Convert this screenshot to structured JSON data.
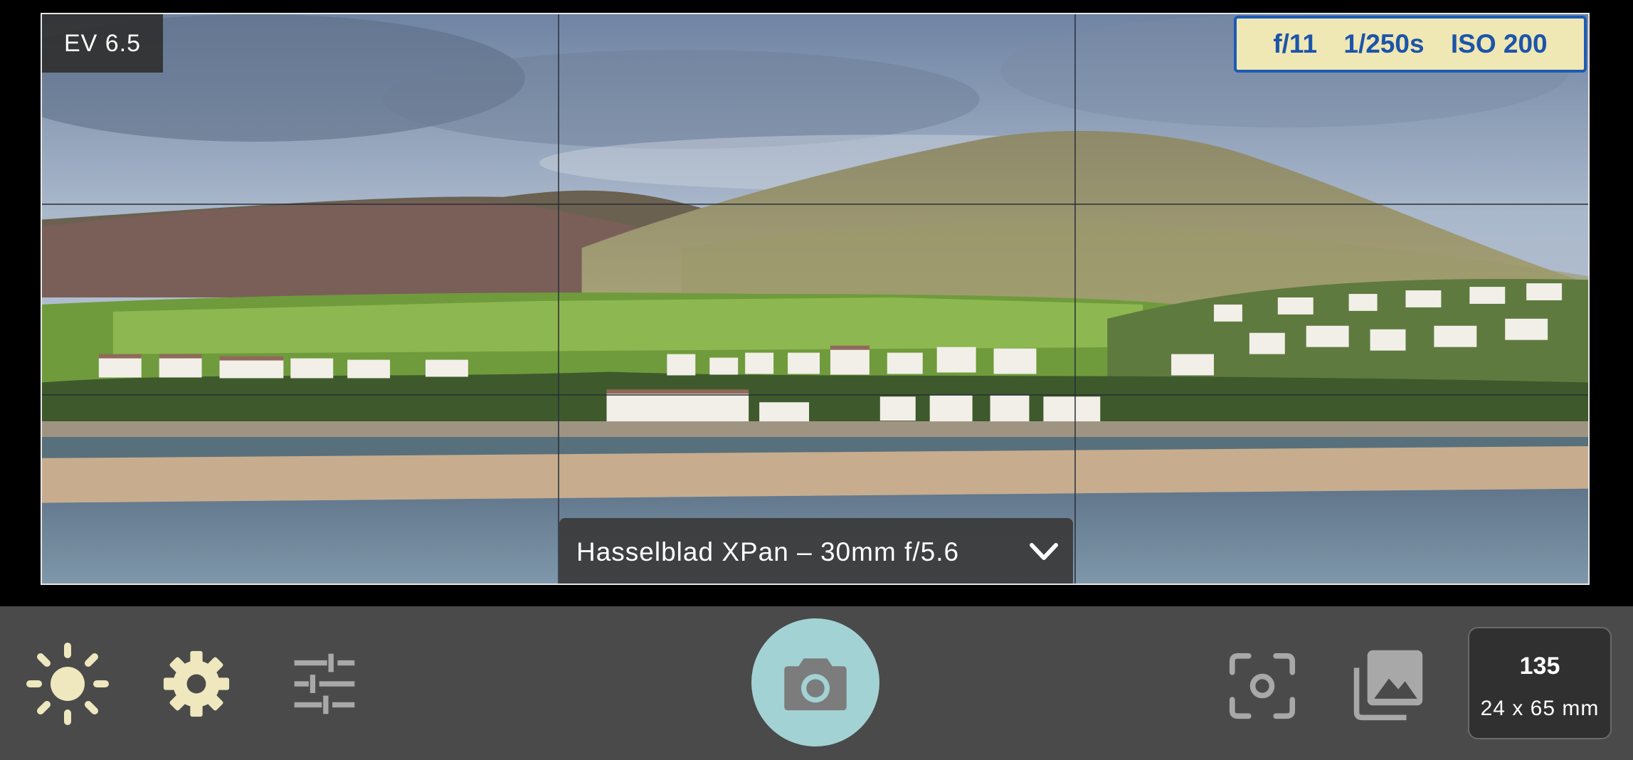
{
  "viewfinder": {
    "ev_label": "EV 6.5",
    "exposure": {
      "aperture": "f/11",
      "shutter": "1/250s",
      "iso": "ISO 200"
    },
    "lens_selector": {
      "label": "Hasselblad XPan – 30mm f/5.6",
      "icon": "chevron-down-icon"
    }
  },
  "toolbar": {
    "icons": {
      "brightness": "sun-icon",
      "settings": "gear-icon",
      "adjustments": "sliders-icon",
      "shutter": "camera-icon",
      "focus": "focus-target-icon",
      "gallery": "gallery-icon"
    },
    "format": {
      "name": "135",
      "size": "24 x 65 mm"
    }
  },
  "colors": {
    "toolbar_bg": "#4a4a4a",
    "icon_cream": "#efe8bf",
    "shutter_teal": "#a3d2d4",
    "exposure_bg": "#efe7b4",
    "exposure_text": "#1c54aa"
  }
}
